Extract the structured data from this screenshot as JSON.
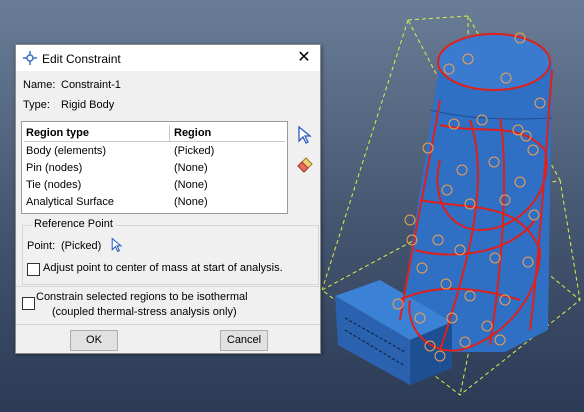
{
  "dialog": {
    "title": "Edit Constraint",
    "name_label": "Name:",
    "name_value": "Constraint-1",
    "type_label": "Type:",
    "type_value": "Rigid Body",
    "table": {
      "headers": [
        "Region type",
        "Region"
      ],
      "rows": [
        [
          "Body (elements)",
          "(Picked)"
        ],
        [
          "Pin (nodes)",
          "(None)"
        ],
        [
          "Tie (nodes)",
          "(None)"
        ],
        [
          "Analytical Surface",
          "(None)"
        ]
      ]
    },
    "reference_point": {
      "legend": "Reference Point",
      "point_label": "Point:",
      "point_value": "(Picked)",
      "adjust_label": "Adjust point to center of mass at start of analysis."
    },
    "isothermal_line1": "Constrain selected regions to be isothermal",
    "isothermal_line2": "(coupled thermal-stress analysis only)",
    "ok_label": "OK",
    "cancel_label": "Cancel",
    "icons": [
      "edit-constraint-icon",
      "close-icon",
      "select-arrow-icon",
      "eraser-icon",
      "pick-arrow-icon"
    ]
  },
  "viewport": {
    "background_top": "#6a7d97",
    "background_bottom": "#2c3b55",
    "model_color": "#2f6fc4",
    "highlight_color": "#e0201a",
    "guide_color": "#d8f04a"
  }
}
